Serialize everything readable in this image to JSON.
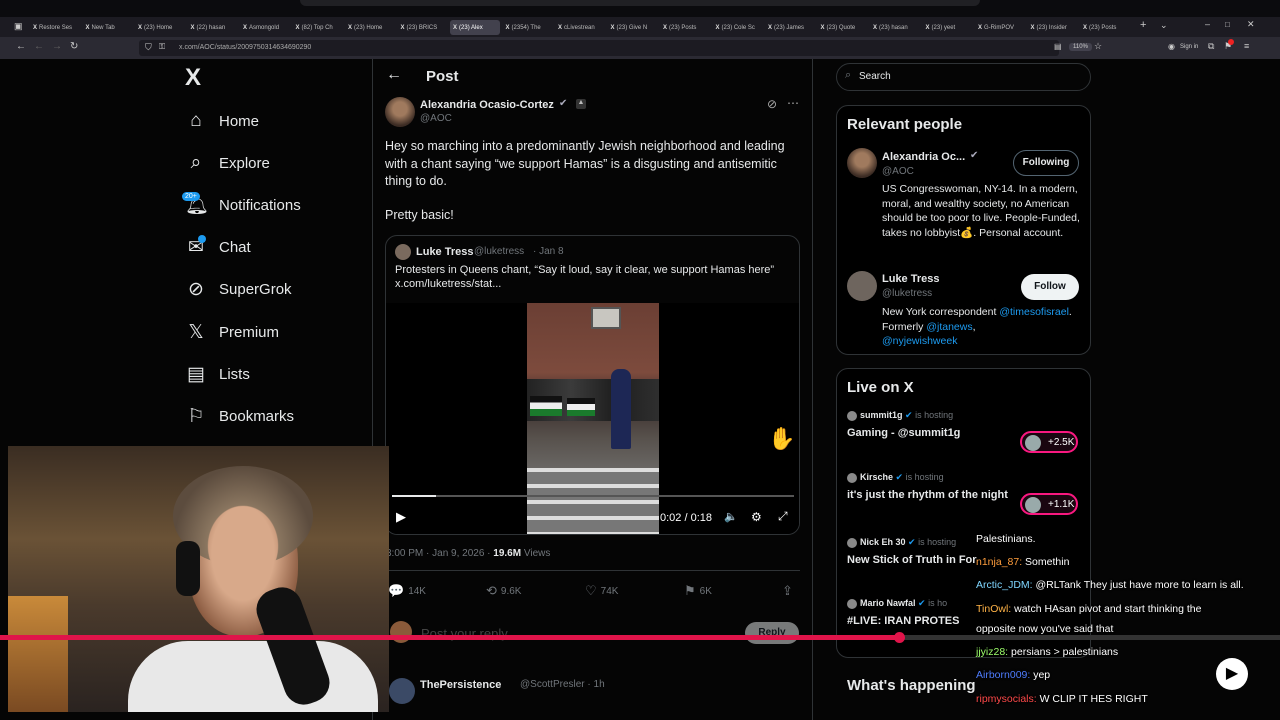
{
  "browser": {
    "tabs": [
      "Restore Ses",
      "New Tab",
      "(23) Home",
      "(22) hasan",
      "Asmongold",
      "(82) Top Ch",
      "(23) Home",
      "(23) BRICS",
      "(23) Alex",
      "(2354) The",
      "cLivestrean",
      "(23) Give N",
      "(23) Posts",
      "(23) Cole Sc",
      "(23) James",
      "(23) Quote",
      "(23) hasan",
      "(23) yeet",
      "G-RimPOV",
      "(23) Insider",
      "(23) Posts"
    ],
    "url": "x.com/AOC/status/2009750314634690290",
    "zoom": "110%",
    "sign_in": "Sign in"
  },
  "nav": {
    "logo": "X",
    "items": [
      {
        "label": "Home",
        "icon": "home-icon"
      },
      {
        "label": "Explore",
        "icon": "search-icon"
      },
      {
        "label": "Notifications",
        "icon": "bell-icon",
        "badge": "20+"
      },
      {
        "label": "Chat",
        "icon": "mail-icon"
      },
      {
        "label": "SuperGrok",
        "icon": "grok-icon"
      },
      {
        "label": "Premium",
        "icon": "x-icon"
      },
      {
        "label": "Lists",
        "icon": "list-icon"
      },
      {
        "label": "Bookmarks",
        "icon": "bookmark-icon"
      }
    ]
  },
  "post": {
    "header": "Post",
    "author_name": "Alexandria Ocasio-Cortez",
    "author_handle": "@AOC",
    "body": "Hey so marching into a predominantly Jewish neighborhood and leading with a chant saying “we support Hamas” is a disgusting and antisemitic thing to do.",
    "body2": "Pretty basic!",
    "quote": {
      "name": "Luke Tress",
      "handle": "@luketress",
      "date": "· Jan 8",
      "text": "Protesters in Queens chant, “Say it loud, say it clear, we support Hamas here”",
      "link": "x.com/luketress/stat...",
      "video_time": "0:02 / 0:18",
      "video_progress": 0.11
    },
    "timestamp": "3:00 PM · Jan 9, 2026 · ",
    "views": "19.6M",
    "views_label": " Views",
    "actions": {
      "replies": "14K",
      "reposts": "9.6K",
      "likes": "74K",
      "bookmarks": "6K"
    },
    "reply_placeholder": "Post your reply",
    "reply_button": "Reply",
    "next_name": "ThePersistence",
    "next_handle": "@ScottPresler · 1h"
  },
  "sidebar": {
    "search_placeholder": "Search",
    "relevant_title": "Relevant people",
    "people": [
      {
        "name": "Alexandria Oc...",
        "handle": "@AOC",
        "bio": "US Congresswoman, NY-14. In a modern, moral, and wealthy society, no American should be too poor to live. People-Funded, takes no lobbyist💰. Personal account.",
        "button": "Following"
      },
      {
        "name": "Luke Tress",
        "handle": "@luketress",
        "bio_prefix": "New York correspondent ",
        "mention1": "@timesofisrael",
        "bio_mid": ". Formerly ",
        "mention2": "@jtanews",
        "bio_end": ",",
        "mention3": "@nyjewishweek",
        "button": "Follow"
      }
    ],
    "live_title": "Live on X",
    "live": [
      {
        "host": "summit1g",
        "status": " is hosting",
        "title": "Gaming - @summit1g",
        "count": "+2.5K"
      },
      {
        "host": "Kirsche",
        "status": " is hosting",
        "title": "it's just the rhythm of the night",
        "count": "+1.1K"
      },
      {
        "host": "Nick Eh 30",
        "status": " is hosting",
        "title": "New Stick of Truth in For",
        "count": ""
      },
      {
        "host": "Mario Nawfal",
        "status": " is ho",
        "title": "#LIVE: IRAN PROTES",
        "count": ""
      }
    ],
    "happening_title": "What's happening"
  },
  "chat": [
    {
      "user": "",
      "msg": "Palestinians.",
      "color": "#ffffff"
    },
    {
      "user": "n1nja_87:",
      "msg": " Somethin",
      "color": "#ff9e3d"
    },
    {
      "user": "Arctic_JDM:",
      "msg": " @RLTank They just have more to learn is all.",
      "color": "#7fd6ff"
    },
    {
      "user": "TinOwl:",
      "msg": " watch HAsan pivot and start thinking the",
      "color": "#ffb347"
    },
    {
      "user": "",
      "msg": "opposite now you've said that",
      "color": "#ffffff"
    },
    {
      "user": "jjyiz28:",
      "msg": " persians > palestinians",
      "color": "#9dff6b"
    },
    {
      "user": "Airborn009:",
      "msg": " yep",
      "color": "#4f7dff"
    },
    {
      "user": "ripmysocials:",
      "msg": " W CLIP IT HES RIGHT",
      "color": "#ff4a4a"
    }
  ],
  "colors": {
    "accent": "#1d9bf0",
    "live_red": "#f91880",
    "stream_bar": "#e0144a"
  }
}
